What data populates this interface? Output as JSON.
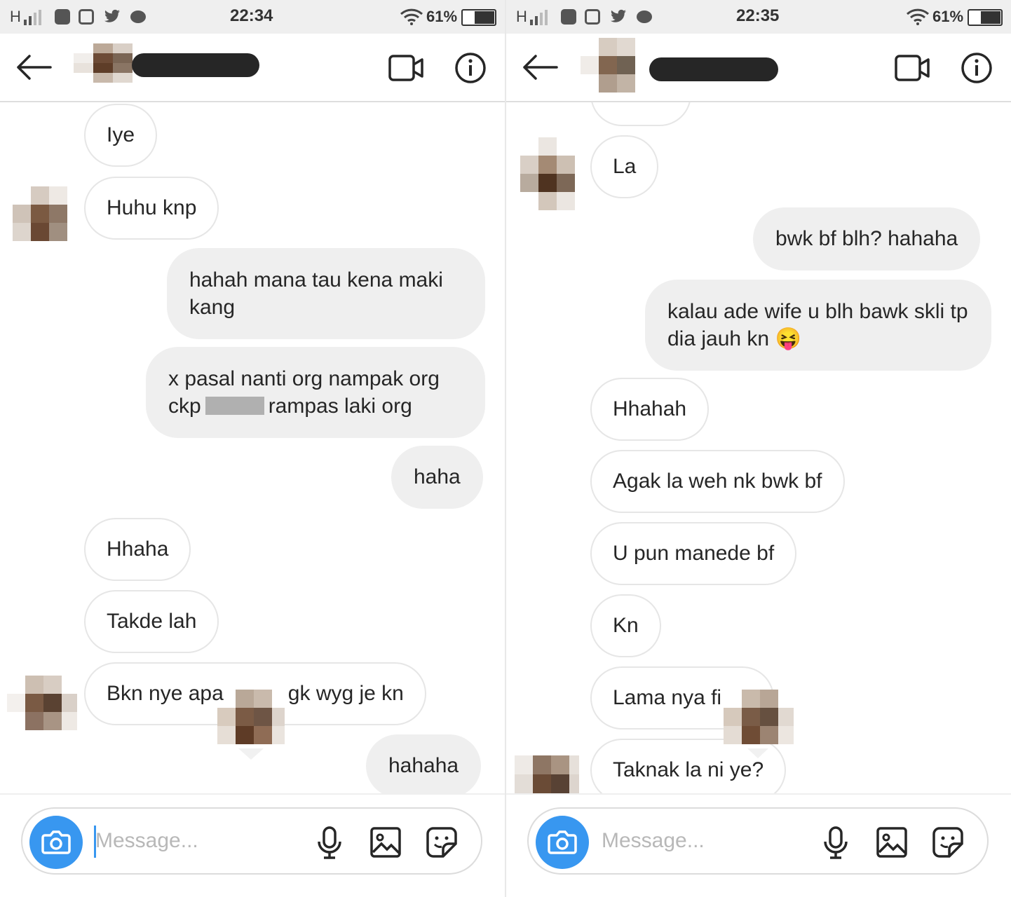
{
  "screens": [
    {
      "status": {
        "network": "H",
        "time": "22:34",
        "battery": "61%"
      },
      "composer_placeholder": "Message...",
      "messages": [
        {
          "text": "Iye",
          "from": "them"
        },
        {
          "text": "Huhu knp",
          "from": "them"
        },
        {
          "text": "hahah mana tau kena maki kang",
          "from": "me"
        },
        {
          "text_before": "x pasal nanti org nampak org ckp",
          "text_after": "rampas laki org",
          "from": "me"
        },
        {
          "text": "haha",
          "from": "me"
        },
        {
          "text": "Hhaha",
          "from": "them"
        },
        {
          "text": "Takde lah",
          "from": "them"
        },
        {
          "text_before": "Bkn nye apa",
          "text_after": "gk wyg je kn",
          "from": "them"
        },
        {
          "text": "hahaha",
          "from": "me"
        }
      ]
    },
    {
      "status": {
        "network": "H",
        "time": "22:35",
        "battery": "61%"
      },
      "composer_placeholder": "Message...",
      "messages": [
        {
          "text": "La",
          "from": "them"
        },
        {
          "text": "bwk bf blh? hahaha",
          "from": "me"
        },
        {
          "text": "kalau ade wife u blh bawk skli tp dia jauh kn",
          "emoji": "😝",
          "from": "me"
        },
        {
          "text": "Hhahah",
          "from": "them"
        },
        {
          "text": "Agak la weh nk bwk bf",
          "from": "them"
        },
        {
          "text": "U pun manede bf",
          "from": "them"
        },
        {
          "text": "Kn",
          "from": "them"
        },
        {
          "text": "Lama nya fi",
          "from": "them"
        },
        {
          "text": "Taknak la ni ye?",
          "from": "them"
        }
      ]
    }
  ],
  "colors": {
    "accent": "#3897f0",
    "outgoing_bubble": "#efefef",
    "incoming_border": "#e6e6e6",
    "text": "#262626"
  },
  "icons": [
    "back-arrow-icon",
    "video-call-icon",
    "info-icon",
    "camera-icon",
    "microphone-icon",
    "gallery-icon",
    "sticker-icon"
  ]
}
